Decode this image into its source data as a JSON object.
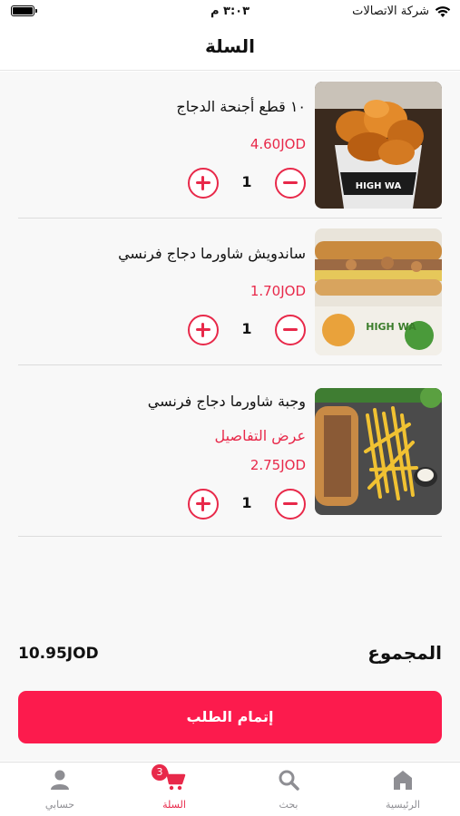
{
  "status_bar": {
    "carrier": "شركة الاتصالات",
    "time": "٣:٠٣ م"
  },
  "header": {
    "title": "السلة"
  },
  "cart": {
    "items": [
      {
        "name": "١٠ قطع أجنحة الدجاج",
        "price": "4.60JOD",
        "quantity": "1",
        "details_link": ""
      },
      {
        "name": "ساندويش شاورما دجاج فرنسي",
        "price": "1.70JOD",
        "quantity": "1",
        "details_link": ""
      },
      {
        "name": "وجبة شاورما دجاج فرنسي",
        "price": "2.75JOD",
        "quantity": "1",
        "details_link": "عرض التفاصيل"
      }
    ]
  },
  "summary": {
    "total_label": "المجموع",
    "total_value": "10.95JOD"
  },
  "checkout": {
    "label": "إتمام الطلب"
  },
  "tabs": [
    {
      "label": "الرئيسية",
      "icon": "home-icon"
    },
    {
      "label": "بحث",
      "icon": "search-icon"
    },
    {
      "label": "السلة",
      "icon": "cart-icon",
      "badge": "3"
    },
    {
      "label": "حسابي",
      "icon": "person-icon"
    }
  ],
  "colors": {
    "accent": "#e8294a",
    "checkout": "#fc1b4d",
    "tab_inactive": "#8e8e93"
  }
}
